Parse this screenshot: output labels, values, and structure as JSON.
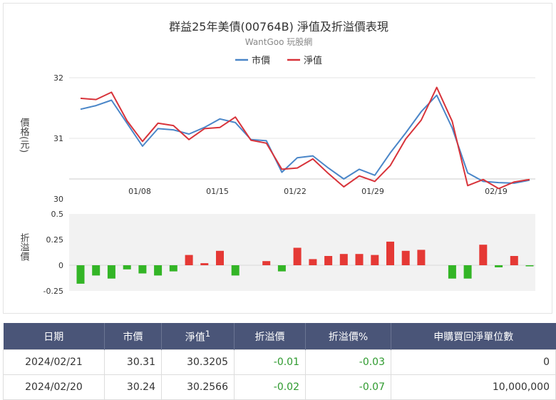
{
  "chart": {
    "title": "群益25年美債(00764B) 淨值及折溢價表現",
    "subtitle": "WantGoo 玩股網",
    "legend": [
      {
        "name": "市價",
        "color": "#4a86c8"
      },
      {
        "name": "淨值",
        "color": "#d8333a"
      }
    ],
    "bar_colors": {
      "positive": "#e53935",
      "negative": "#33b526"
    }
  },
  "chart_data": [
    {
      "type": "line",
      "ylabel": "價格(元)",
      "ylim": [
        30,
        32
      ],
      "yticks": [
        "32",
        "31",
        "30"
      ],
      "xticks": [
        "01/08",
        "01/15",
        "01/22",
        "01/29",
        "02/19"
      ],
      "series": [
        {
          "name": "市價",
          "values": [
            31.48,
            31.54,
            31.63,
            31.25,
            30.87,
            31.16,
            31.14,
            31.07,
            31.18,
            31.32,
            31.26,
            30.98,
            30.96,
            30.44,
            30.68,
            30.71,
            30.51,
            30.33,
            30.49,
            30.39,
            30.76,
            31.09,
            31.44,
            31.71,
            31.17,
            30.43,
            30.29,
            30.27,
            30.26,
            30.31
          ]
        },
        {
          "name": "淨值",
          "values": [
            31.66,
            31.64,
            31.76,
            31.29,
            30.95,
            31.25,
            31.21,
            30.98,
            31.16,
            31.18,
            31.35,
            30.97,
            30.92,
            30.49,
            30.51,
            30.66,
            30.42,
            30.2,
            30.38,
            30.29,
            30.55,
            30.99,
            31.3,
            31.84,
            31.28,
            30.22,
            30.32,
            30.17,
            30.28,
            30.32
          ]
        }
      ]
    },
    {
      "type": "bar",
      "ylabel": "折溢價",
      "ylim": [
        -0.25,
        0.5
      ],
      "yticks": [
        "0.5",
        "0.25",
        "0",
        "-0.25"
      ],
      "series": [
        {
          "name": "折溢價",
          "values": [
            -0.18,
            -0.1,
            -0.13,
            -0.04,
            -0.08,
            -0.1,
            -0.06,
            0.1,
            0.02,
            0.14,
            -0.1,
            0.0,
            0.04,
            -0.06,
            0.17,
            0.06,
            0.09,
            0.11,
            0.11,
            0.1,
            0.23,
            0.14,
            0.15,
            0.0,
            -0.13,
            -0.13,
            0.2,
            -0.02,
            0.09,
            -0.01
          ]
        }
      ]
    }
  ],
  "table": {
    "headers": {
      "date": "日期",
      "price": "市價",
      "nav": "淨值",
      "nav_sup": "1",
      "premium": "折溢價",
      "premium_pct": "折溢價%",
      "units": "申購買回淨單位數"
    },
    "rows": [
      {
        "date": "2024/02/21",
        "price": "30.31",
        "nav": "30.3205",
        "premium": "-0.01",
        "premium_pct": "-0.03",
        "units": "0"
      },
      {
        "date": "2024/02/20",
        "price": "30.24",
        "nav": "30.2566",
        "premium": "-0.02",
        "premium_pct": "-0.07",
        "units": "10,000,000"
      }
    ]
  }
}
